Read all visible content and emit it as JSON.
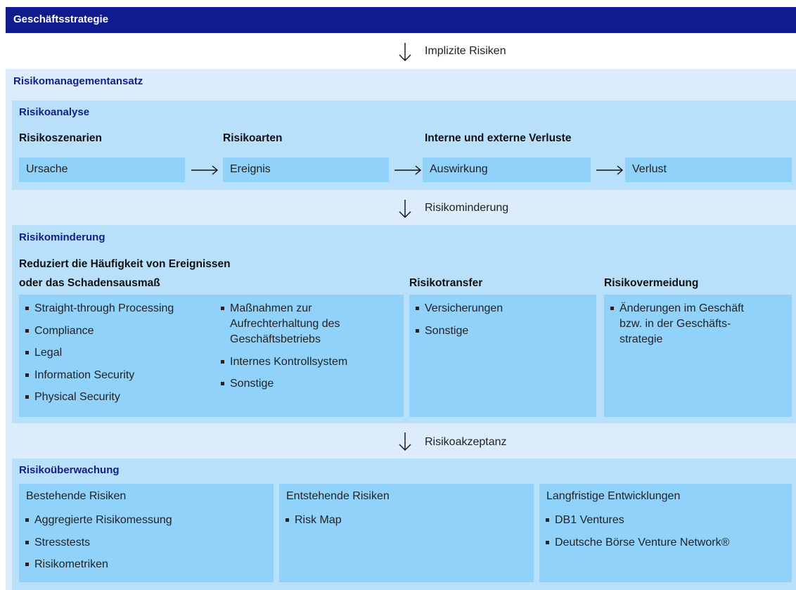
{
  "strategy_title": "Geschäftsstrategie",
  "flow_labels": {
    "implicit": "Implizite Risiken",
    "mitigation": "Risikominderung",
    "acceptance": "Risikoakzeptanz"
  },
  "approach_title": "Risikomanagementansatz",
  "analysis": {
    "title": "Risikoanalyse",
    "headers": [
      "Risikoszenarien",
      "Risikoarten",
      "Interne und externe Verluste"
    ],
    "boxes": [
      "Ursache",
      "Ereignis",
      "Auswirkung",
      "Verlust"
    ]
  },
  "mitigation": {
    "title": "Risikominderung",
    "reduce_heading": [
      "Reduziert die Häufigkeit von Ereignissen",
      "oder das Schadensausmaß"
    ],
    "transfer_heading": "Risikotransfer",
    "avoid_heading": "Risikovermeidung",
    "reduce_col1": [
      "Straight-through Processing",
      "Compliance",
      "Legal",
      "Information Security",
      "Physical Security"
    ],
    "reduce_col2": [
      [
        "Maßnahmen zur",
        "Aufrechterhaltung des",
        "Geschäftsbetriebs"
      ],
      [
        "Internes Kontrollsystem"
      ],
      [
        "Sonstige"
      ]
    ],
    "transfer_items": [
      "Versicherungen",
      "Sonstige"
    ],
    "avoid_items": [
      [
        "Änderungen im Geschäft",
        "bzw. in der Geschäfts-",
        "strategie"
      ]
    ]
  },
  "monitoring": {
    "title": "Risikoüberwachung",
    "columns": [
      {
        "heading": "Bestehende Risiken",
        "items": [
          "Aggregierte Risikomessung",
          "Stresstests",
          "Risikometriken"
        ]
      },
      {
        "heading": "Entstehende Risiken",
        "items": [
          "Risk Map"
        ]
      },
      {
        "heading": "Langfristige Entwicklungen",
        "items": [
          "DB1 Ventures",
          "Deutsche Börse Venture Network®"
        ]
      }
    ]
  }
}
